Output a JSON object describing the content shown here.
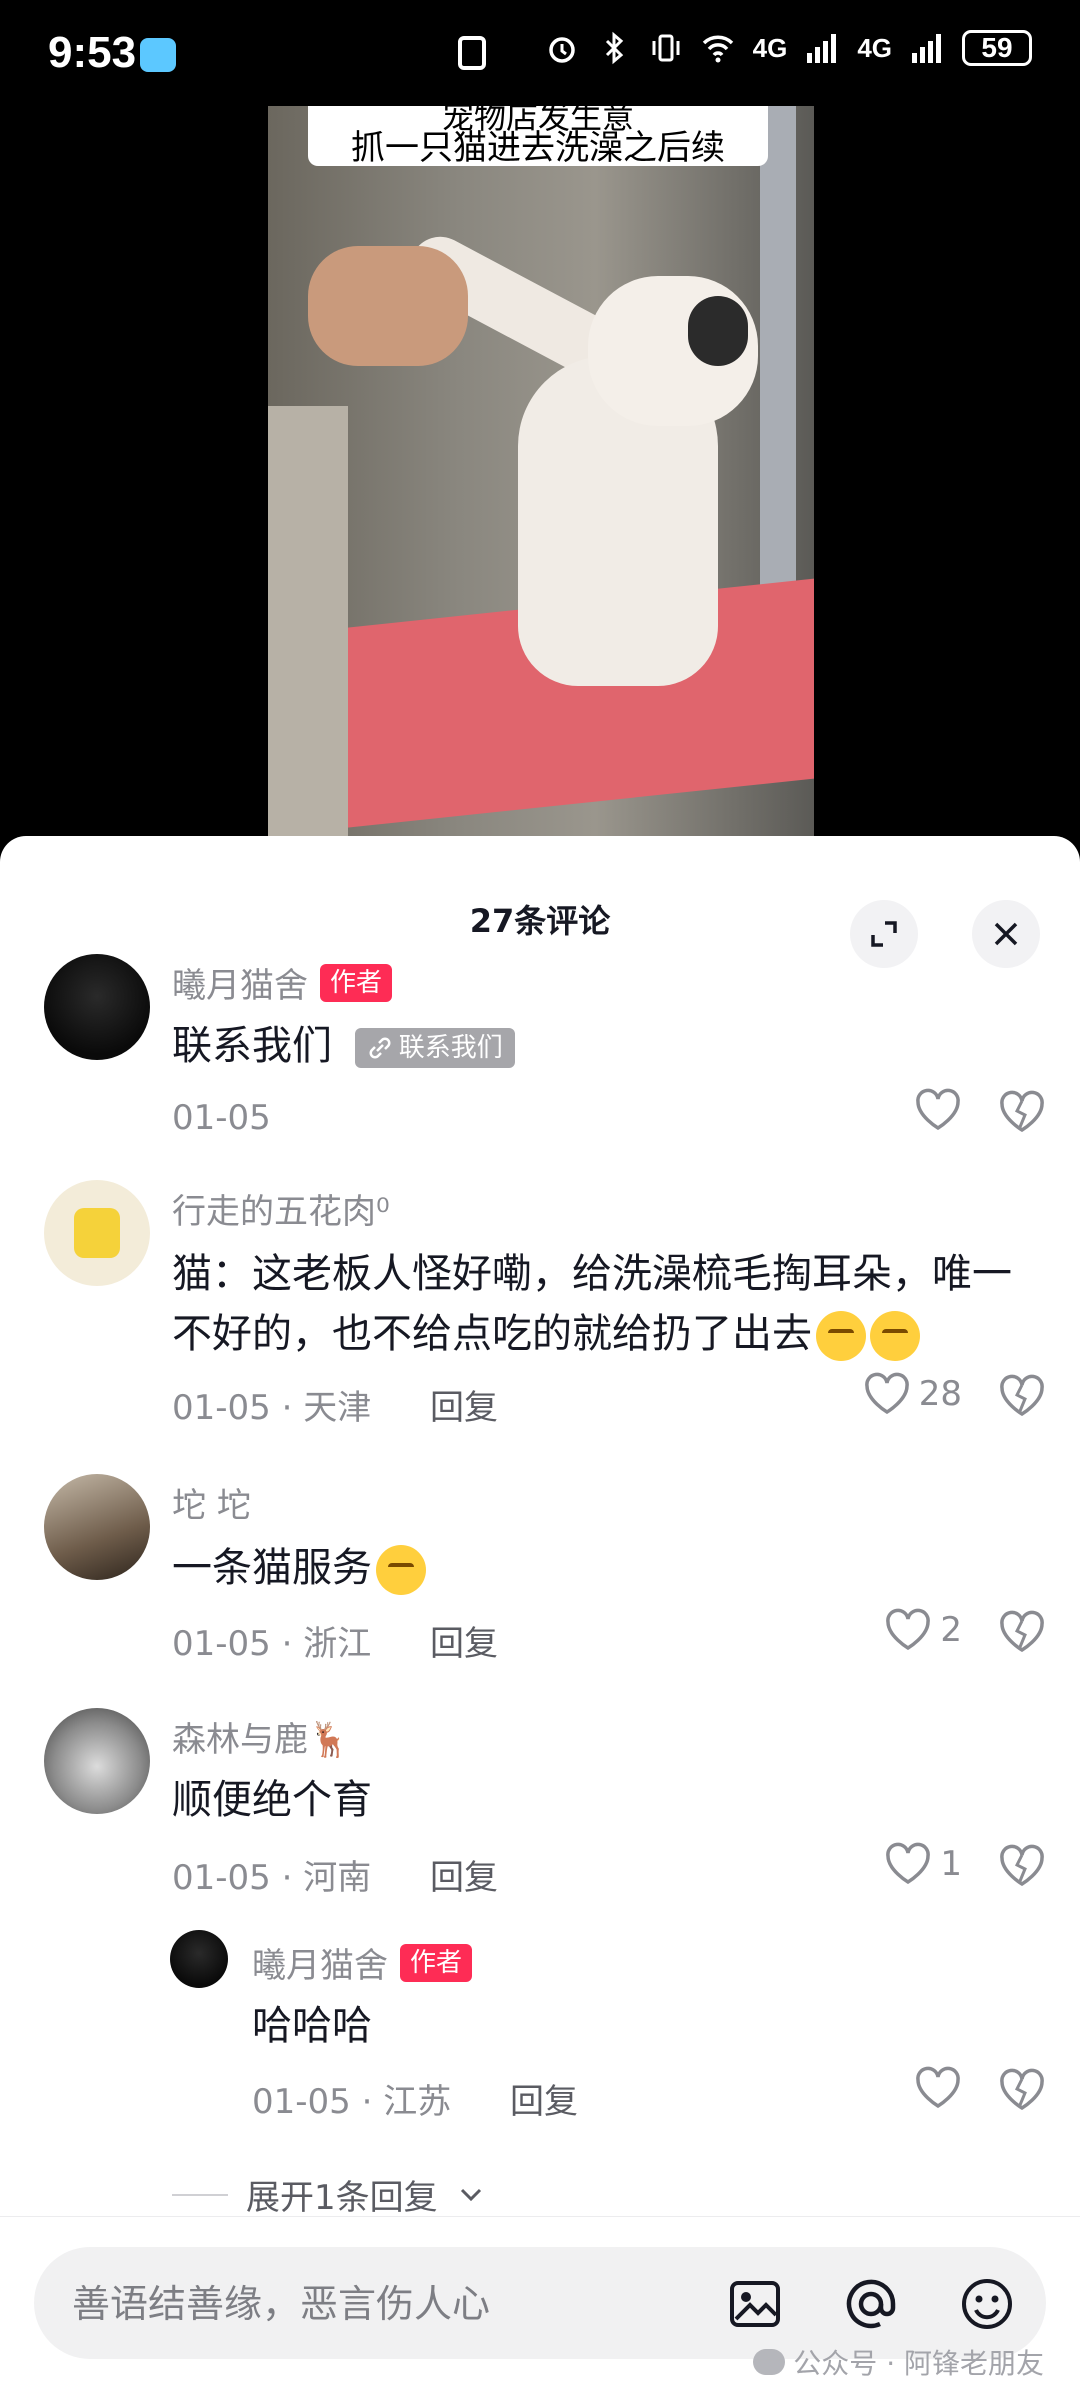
{
  "status_bar": {
    "time": "9:53",
    "battery": "59",
    "network_1": "4G",
    "network_2": "4G"
  },
  "video": {
    "caption_top": "宠物店发生意",
    "caption_main": "抓一只猫进去洗澡之后续"
  },
  "sheet": {
    "title": "27条评论"
  },
  "comments": [
    {
      "name": "曦月猫舍",
      "badge": "作者",
      "text": "联系我们",
      "link_label": "联系我们",
      "date": "01-05",
      "likes": ""
    },
    {
      "name": "行走的五花肉⁰",
      "text": "猫：这老板人怪好嘞，给洗澡梳毛掏耳朵，唯一不好的，也不给点吃的就给扔了出去",
      "date": "01-05 · 天津",
      "reply": "回复",
      "likes": "28"
    },
    {
      "name": "坨 坨",
      "text": "一条猫服务",
      "date": "01-05 · 浙江",
      "reply": "回复",
      "likes": "2"
    },
    {
      "name": "森林与鹿🦌",
      "text": "顺便绝个育",
      "date": "01-05 · 河南",
      "reply": "回复",
      "likes": "1"
    },
    {
      "name": "曦月猫舍",
      "badge": "作者",
      "text": "哈哈哈",
      "date": "01-05 · 江苏",
      "reply": "回复",
      "likes": ""
    }
  ],
  "expand_replies": "展开1条回复",
  "input": {
    "placeholder": "善语结善缘，恶言伤人心"
  },
  "watermark": "公众号 · 阿锋老朋友",
  "icons": [
    "alarm-icon",
    "bluetooth-icon",
    "vibrate-icon",
    "wifi-icon",
    "signal-icon",
    "expand-icon",
    "close-icon",
    "heart-icon",
    "broken-heart-icon",
    "image-icon",
    "at-icon",
    "emoji-icon",
    "link-icon",
    "chevron-down-icon"
  ],
  "colors": {
    "accent": "#fe2c55",
    "secondary_text": "#8a8b91",
    "primary_text": "#161823"
  }
}
